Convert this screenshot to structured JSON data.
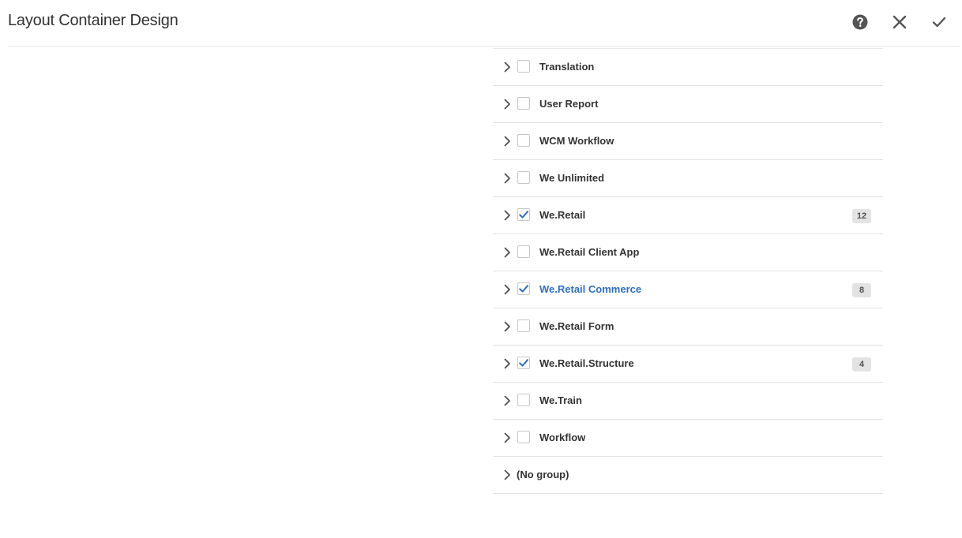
{
  "header": {
    "title": "Layout Container Design",
    "help_icon": "help-circle-icon",
    "close_icon": "close-icon",
    "confirm_icon": "checkmark-icon"
  },
  "colors": {
    "accent": "#2d6ec2",
    "icon": "#555555"
  },
  "groups": [
    {
      "label": "Translation",
      "checked": false,
      "badge": ""
    },
    {
      "label": "User Report",
      "checked": false,
      "badge": ""
    },
    {
      "label": "WCM Workflow",
      "checked": false,
      "badge": ""
    },
    {
      "label": "We Unlimited",
      "checked": false,
      "badge": ""
    },
    {
      "label": "We.Retail",
      "checked": true,
      "badge": "12"
    },
    {
      "label": "We.Retail Client App",
      "checked": false,
      "badge": ""
    },
    {
      "label": "We.Retail Commerce",
      "checked": true,
      "badge": "8",
      "active": true
    },
    {
      "label": "We.Retail Form",
      "checked": false,
      "badge": ""
    },
    {
      "label": "We.Retail.Structure",
      "checked": true,
      "badge": "4"
    },
    {
      "label": "We.Train",
      "checked": false,
      "badge": ""
    },
    {
      "label": "Workflow",
      "checked": false,
      "badge": ""
    },
    {
      "label": "(No group)",
      "checkbox": false,
      "badge": ""
    }
  ]
}
